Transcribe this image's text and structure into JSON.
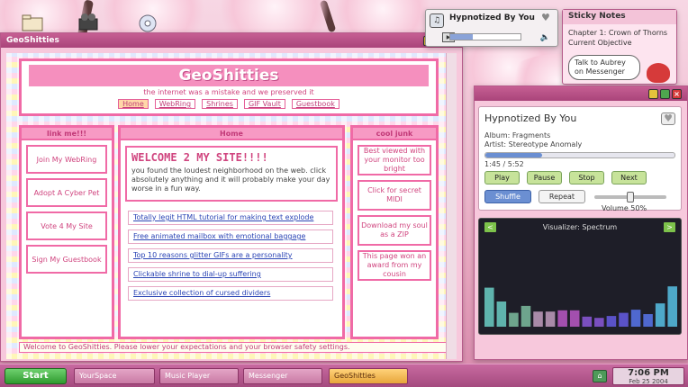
{
  "geo": {
    "window_title": "GeoShitties",
    "logo": "GeoShitties",
    "tagline": "the internet was a mistake and we preserved it",
    "nav": [
      "Home",
      "WebRing",
      "Shrines",
      "GIF Vault",
      "Guestbook"
    ],
    "left_header": "link me!!!",
    "left_items": [
      "Join My WebRing",
      "Adopt A Cyber Pet",
      "Vote 4 My Site",
      "Sign My Guestbook"
    ],
    "mid_header": "Home",
    "welcome_title": "WELCOME 2 MY SITE!!!!",
    "welcome_text": "you found the loudest neighborhood on the web. click absolutely anything and it will probably make your day worse in a fun way.",
    "links": [
      "Totally legit HTML tutorial for making text explode",
      "Free animated mailbox with emotional baggage",
      "Top 10 reasons glitter GIFs are a personality",
      "Clickable shrine to dial-up suffering",
      "Exclusive collection of cursed dividers"
    ],
    "right_header": "cool junk",
    "right_items": [
      "Best viewed with your monitor too bright",
      "Click for secret MIDI",
      "Download my soul as a ZIP",
      "This page won an award from my cousin"
    ],
    "status": "Welcome to GeoShitties. Please lower your expectations and your browser safety settings."
  },
  "mini_player": {
    "title": "Hypnotized By You",
    "progress": 0.32
  },
  "sticky": {
    "title": "Sticky Notes",
    "line1": "Chapter 1: Crown of Thorns",
    "line2": "Current Objective",
    "bubble": "Talk to Aubrey on Messenger"
  },
  "player": {
    "title": "Hypnotized By You",
    "album": "Album: Fragments",
    "artist": "Artist: Stereotype Anomaly",
    "time": "1:45 / 5:52",
    "progress": 0.3,
    "controls": [
      "Play",
      "Pause",
      "Stop",
      "Next"
    ],
    "shuffle": "Shuffle",
    "repeat": "Repeat",
    "volume_label": "Volume 50%",
    "volume": 0.5,
    "visualizer_title": "Visualizer: Spectrum",
    "viz_prev": "<",
    "viz_next": ">",
    "viz_levels": [
      0.62,
      0.4,
      0.22,
      0.33,
      0.24,
      0.24,
      0.26,
      0.26,
      0.16,
      0.14,
      0.17,
      0.22,
      0.27,
      0.2,
      0.37,
      0.64
    ],
    "viz_colors": [
      "#5fb3ad",
      "#5fb3ad",
      "#6ea58d",
      "#6ea58d",
      "#a88aa8",
      "#a88aa8",
      "#a34fae",
      "#a34fae",
      "#7a4fbf",
      "#7a4fbf",
      "#5a52c8",
      "#5a52c8",
      "#4f68cf",
      "#4f68cf",
      "#4ea8c9",
      "#4ea8c9"
    ]
  },
  "taskbar": {
    "start": "Start",
    "tasks": [
      "YourSpace",
      "Music Player",
      "Messenger",
      "GeoShitties"
    ],
    "time": "7:06 PM",
    "date": "Feb 25 2004"
  }
}
